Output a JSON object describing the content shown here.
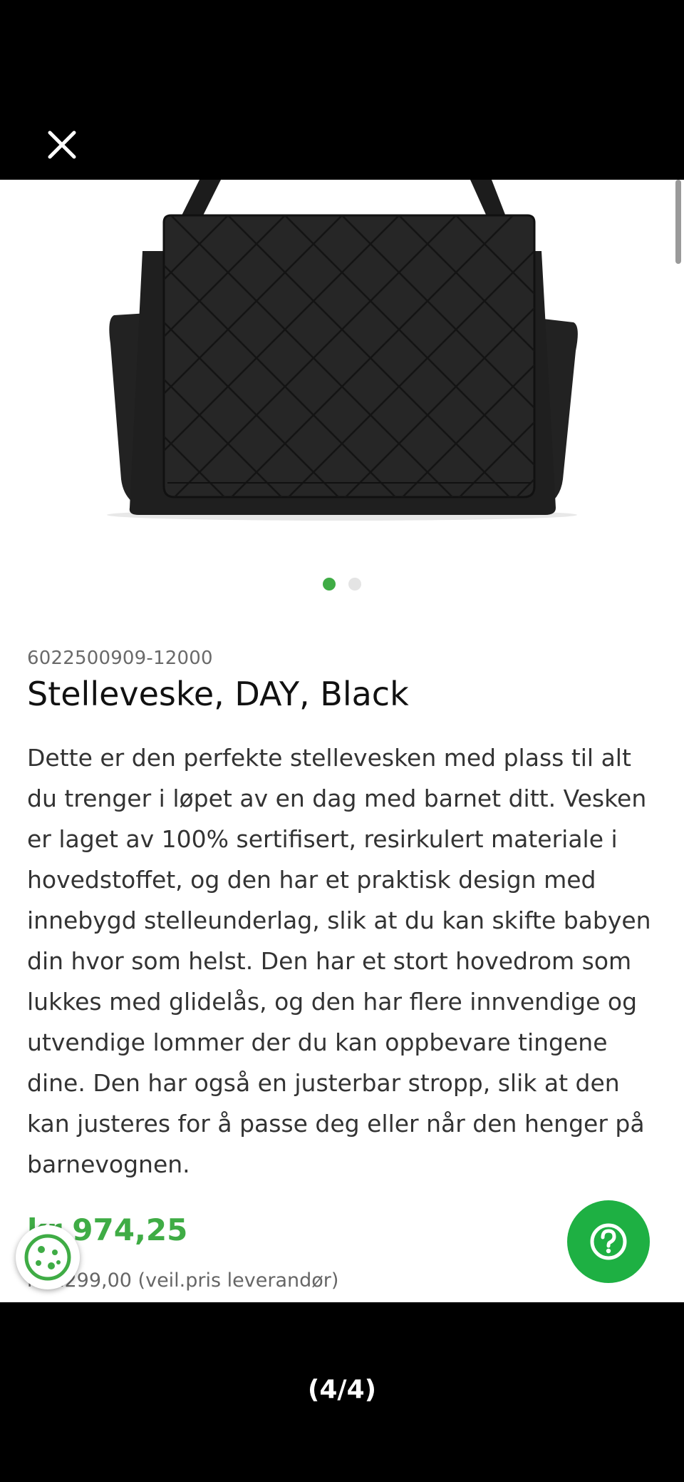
{
  "viewer": {
    "close_icon": "close-icon",
    "counter": "(4/4)"
  },
  "product": {
    "image_icon": "quilted-changing-bag-image",
    "carousel": {
      "total": 2,
      "active_index": 0
    },
    "sku": "6022500909-12000",
    "title": "Stelleveske, DAY, Black",
    "description": "Dette er den perfekte stellevesken med plass til alt du trenger i løpet av en dag med barnet ditt. Vesken er laget av 100% sertifisert, resirkulert materiale i hovedstoffet, og den har et praktisk design med innebygd stelleunderlag, slik at du kan skifte babyen din hvor som helst. Den har et stort hovedrom som lukkes med glidelås, og den har flere innvendige og utvendige lommer der du kan oppbevare tingene dine. Den har også en justerbar stropp, slik at den kan justeres for å passe deg eller når den henger på barnevognen.",
    "price": "kr 974,25",
    "old_price": "kr 1299,00 (veil.pris leverandør)"
  },
  "widgets": {
    "cookie_icon": "cookie-icon",
    "help_icon": "help-question-icon"
  },
  "colors": {
    "accent_green": "#3fac45",
    "help_button_green": "#1eb043",
    "overlay_black": "#000000"
  }
}
